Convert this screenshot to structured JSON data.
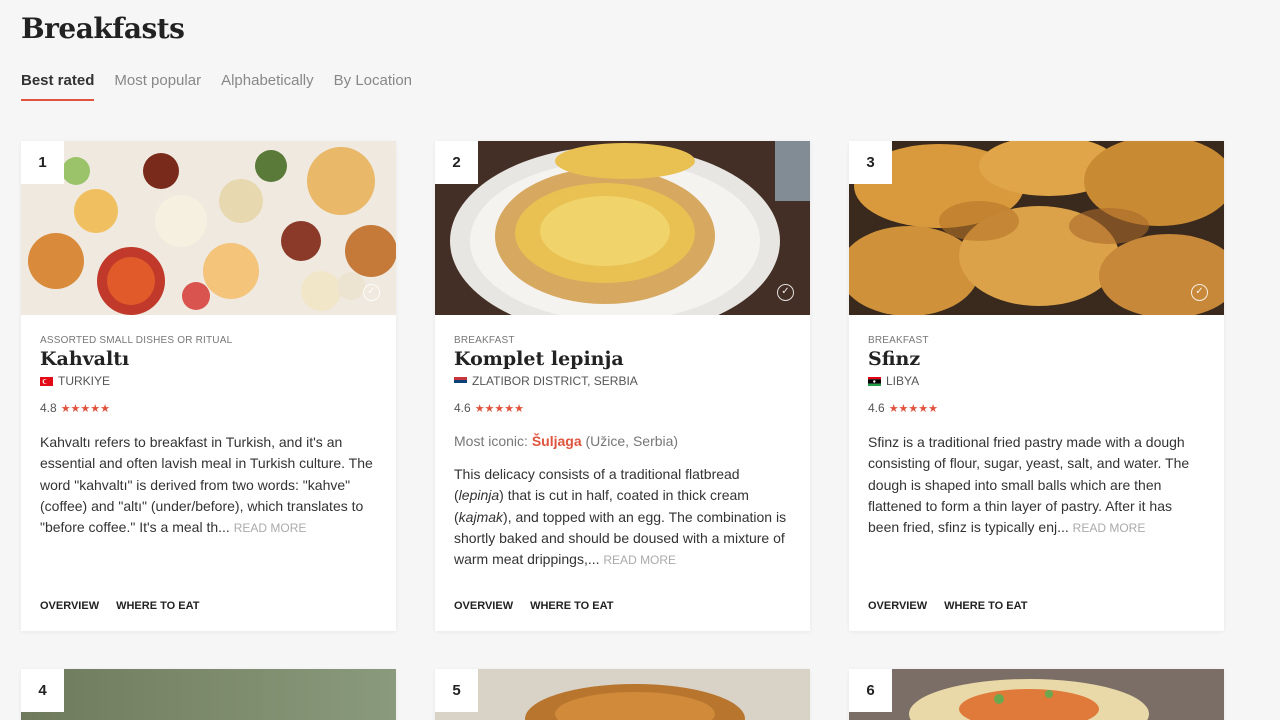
{
  "page": {
    "title": "Breakfasts"
  },
  "tabs": [
    {
      "label": "Best rated",
      "active": true
    },
    {
      "label": "Most popular",
      "active": false
    },
    {
      "label": "Alphabetically",
      "active": false
    },
    {
      "label": "By Location",
      "active": false
    }
  ],
  "cards": [
    {
      "rank": "1",
      "category": "ASSORTED SMALL DISHES OR RITUAL",
      "name": "Kahvaltı",
      "origin": "TURKIYE",
      "rating": "4.8",
      "stars": "★★★★★",
      "description": "Kahvaltı refers to breakfast in Turkish, and it's an essential and often lavish meal in Turkish culture. The word \"kahvaltı\" is derived from two words: \"kahve\" (coffee) and \"altı\" (under/before), which translates to \"before coffee.\" It's a meal th...",
      "read_more": "READ MORE",
      "overview": "OVERVIEW",
      "where_to_eat": "WHERE TO EAT"
    },
    {
      "rank": "2",
      "category": "BREAKFAST",
      "name": "Komplet lepinja",
      "origin": "ZLATIBOR DISTRICT, SERBIA",
      "rating": "4.6",
      "stars": "★★★★★",
      "iconic_label": "Most iconic:",
      "iconic_dish": "Šuljaga",
      "iconic_place": "(Užice, Serbia)",
      "description_1": "This delicacy consists of a traditional flatbread (",
      "description_em1": "lepinja",
      "description_2": ") that is cut in half, coated in thick cream (",
      "description_em2": "kajmak",
      "description_3": "), and topped with an egg. The combination is shortly baked and should be doused with a mixture of warm meat drippings,...",
      "read_more": "READ MORE",
      "overview": "OVERVIEW",
      "where_to_eat": "WHERE TO EAT"
    },
    {
      "rank": "3",
      "category": "BREAKFAST",
      "name": "Sfinz",
      "origin": "LIBYA",
      "rating": "4.6",
      "stars": "★★★★★",
      "description": "Sfinz is a traditional fried pastry made with a dough consisting of flour, sugar, yeast, salt, and water. The dough is shaped into small balls which are then flattened to form a thin layer of pastry. After it has been fried, sfinz is typically enj...",
      "read_more": "READ MORE",
      "overview": "OVERVIEW",
      "where_to_eat": "WHERE TO EAT"
    },
    {
      "rank": "4"
    },
    {
      "rank": "5"
    },
    {
      "rank": "6"
    }
  ],
  "colors": {
    "accent": "#e0533d",
    "background": "#f6f6f6"
  }
}
